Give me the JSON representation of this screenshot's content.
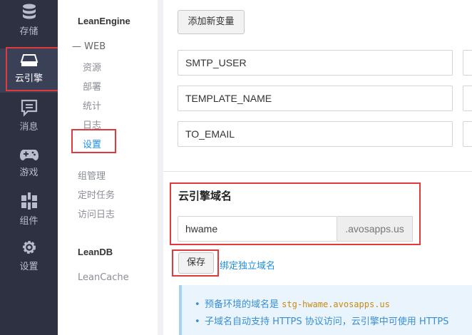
{
  "rail": {
    "items": [
      {
        "label": "存储",
        "icon": "database-icon"
      },
      {
        "label": "云引擎",
        "icon": "server-icon"
      },
      {
        "label": "消息",
        "icon": "chat-icon"
      },
      {
        "label": "游戏",
        "icon": "gamepad-icon"
      },
      {
        "label": "组件",
        "icon": "components-icon"
      },
      {
        "label": "设置",
        "icon": "gear-icon"
      }
    ],
    "active_index": 1
  },
  "subnav": {
    "group1": "LeanEngine",
    "web_label": "WEB",
    "web_prefix": "—",
    "web_items": [
      "资源",
      "部署",
      "统计",
      "日志",
      "设置"
    ],
    "other_items": [
      "组管理",
      "定时任务",
      "访问日志"
    ],
    "group2": "LeanDB",
    "leancache": "LeanCache"
  },
  "main": {
    "add_var_button": "添加新变量",
    "vars": [
      "SMTP_USER",
      "TEMPLATE_NAME",
      "TO_EMAIL"
    ],
    "domain_section": {
      "title": "云引擎域名",
      "subdomain_value": "hwame",
      "suffix": ".avosapps.us",
      "save_button": "保存",
      "bind_link": "绑定独立域名"
    },
    "notice": {
      "line1_prefix": "预备环境的域名是",
      "line1_code": "stg-hwame.avosapps.us",
      "line2": "子域名自动支持 HTTPS 协议访问，云引擎中可使用 HTTPS"
    }
  },
  "colors": {
    "rail_bg": "#2d3142",
    "accent": "#1e8fe1",
    "highlight": "#e03a3a"
  }
}
